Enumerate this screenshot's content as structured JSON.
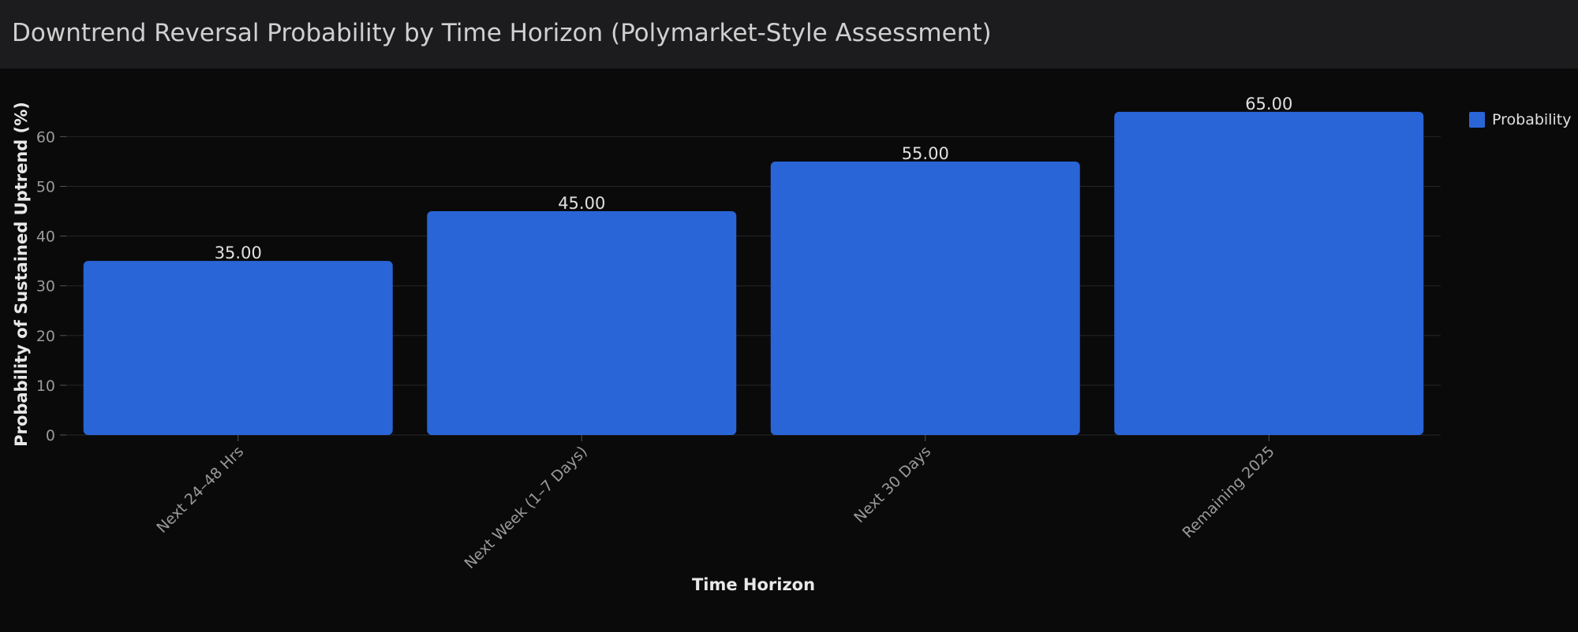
{
  "header": {
    "title": "Downtrend Reversal Probability by Time Horizon (Polymarket-Style Assessment)"
  },
  "colors": {
    "background": "#0a0a0a",
    "header_bg": "#1c1c1e",
    "bar": "#2a65d8",
    "grid": "#262626",
    "text": "#e0e0e0",
    "tick_text": "#9a9a9a"
  },
  "chart_data": {
    "type": "bar",
    "categories": [
      "Next 24–48 Hrs",
      "Next Week (1–7 Days)",
      "Next 30 Days",
      "Remaining 2025"
    ],
    "series": [
      {
        "name": "Probability",
        "values": [
          35,
          45,
          55,
          65
        ]
      }
    ],
    "data_labels": [
      "35.00",
      "45.00",
      "55.00",
      "65.00"
    ],
    "xlabel": "Time Horizon",
    "ylabel": "Probability of Sustained Uptrend (%)",
    "ylim": [
      0,
      65
    ],
    "yticks": [
      0,
      10,
      20,
      30,
      40,
      50,
      60
    ],
    "grid": true,
    "legend_position": "top-right"
  }
}
